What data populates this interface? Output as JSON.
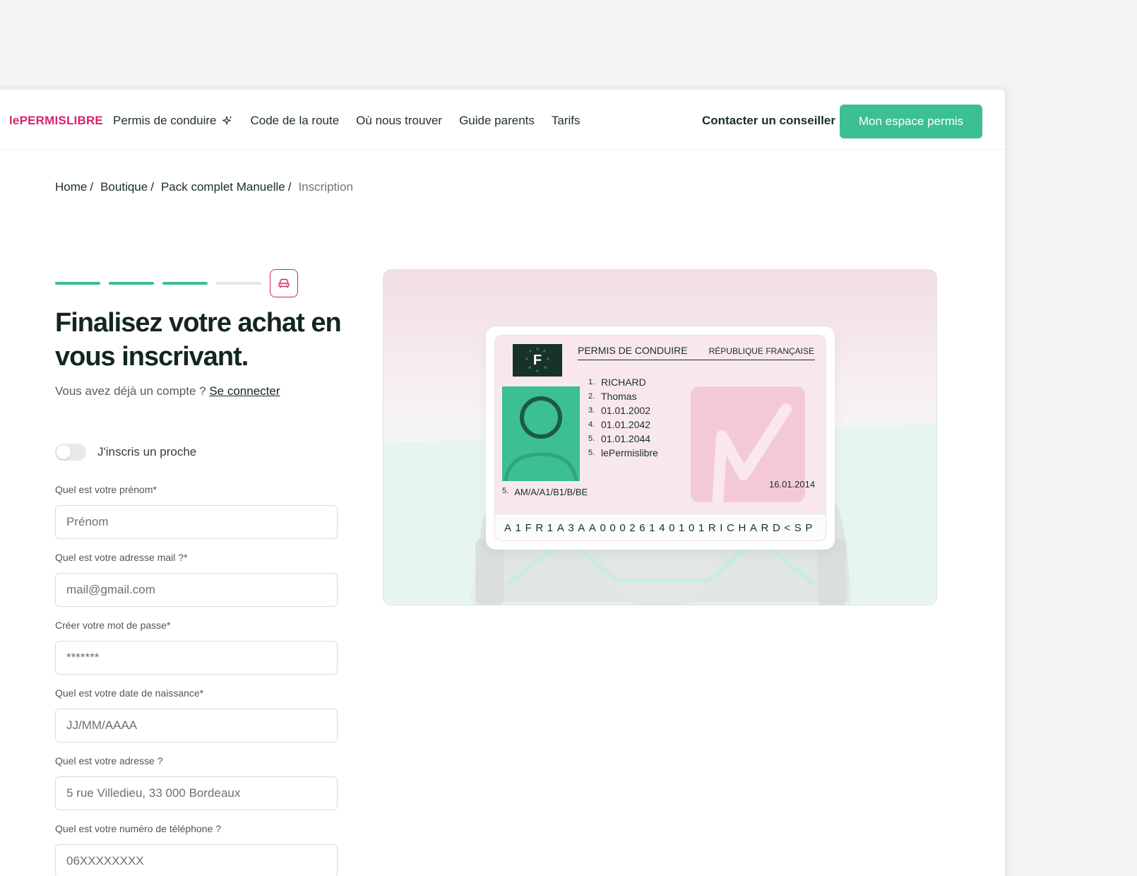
{
  "nav": {
    "logo": "lePERMISLIBRE",
    "links": [
      "Permis de conduire",
      "Code de la route",
      "Où nous trouver",
      "Guide parents",
      "Tarifs"
    ],
    "contact": "Contacter un conseiller",
    "cta": "Mon espace permis"
  },
  "breadcrumb": {
    "items": [
      "Home",
      "Boutique",
      "Pack complet Manuelle"
    ],
    "separator": "/",
    "current": "Inscription"
  },
  "progress": {
    "total_steps": 4,
    "completed_steps": 3,
    "final_icon": "car-icon"
  },
  "heading": {
    "title": "Finalisez votre achat en vous inscrivant.",
    "subtitle": "Vous avez déjà un compte ?",
    "login_link": "Se connecter"
  },
  "toggle": {
    "label": "J'inscris un proche",
    "on": false
  },
  "form": {
    "fields": [
      {
        "label": "Quel est votre prénom*",
        "placeholder": "Prénom"
      },
      {
        "label": "Quel est votre adresse mail ?*",
        "placeholder": "mail@gmail.com"
      },
      {
        "label": "Créer votre mot de passe*",
        "placeholder": "*******"
      },
      {
        "label": "Quel est votre date de naissance*",
        "placeholder": "JJ/MM/AAAA"
      },
      {
        "label": "Quel est votre adresse ?",
        "placeholder": "5 rue Villedieu, 33 000 Bordeaux"
      },
      {
        "label": "Quel est votre numéro de téléphone ?",
        "placeholder": "06XXXXXXXX"
      }
    ]
  },
  "license_card": {
    "flag_letter": "F",
    "title": "PERMIS DE CONDUIRE",
    "country": "RÉPUBLIQUE FRANÇAISE",
    "fields": [
      {
        "num": "1.",
        "value": "RICHARD"
      },
      {
        "num": "2.",
        "value": "Thomas"
      },
      {
        "num": "3.",
        "value": "01.01.2002"
      },
      {
        "num": "4.",
        "value": "01.01.2042"
      },
      {
        "num": "5.",
        "value": "01.01.2044"
      },
      {
        "num": "5.",
        "value": "lePermislibre"
      }
    ],
    "date": "16.01.2014",
    "categories_num": "5.",
    "categories": "AM/A/A1/B1/B/BE",
    "mrz": "A1FR1A3AA00026140101RICHARD<SP"
  },
  "colors": {
    "brand_pink": "#d4246f",
    "brand_green": "#3bbf93",
    "dark": "#13261f"
  }
}
